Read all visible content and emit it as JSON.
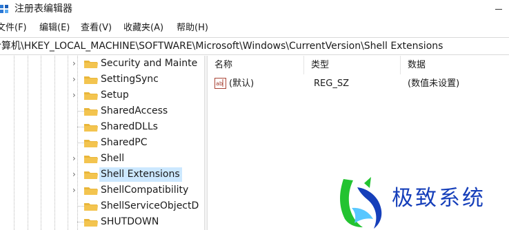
{
  "titlebar": {
    "title": "注册表编辑器",
    "icon": "registry-editor-icon"
  },
  "menubar": {
    "file": "文件(F)",
    "edit": "编辑(E)",
    "view": "查看(V)",
    "favorites": "收藏夹(A)",
    "help": "帮助(H)"
  },
  "addressbar": {
    "path": "计算机\\HKEY_LOCAL_MACHINE\\SOFTWARE\\Microsoft\\Windows\\CurrentVersion\\Shell Extensions"
  },
  "tree": {
    "items": [
      {
        "label": "Security and Mainte",
        "expandable": true,
        "selected": false
      },
      {
        "label": "SettingSync",
        "expandable": true,
        "selected": false
      },
      {
        "label": "Setup",
        "expandable": true,
        "selected": false
      },
      {
        "label": "SharedAccess",
        "expandable": false,
        "selected": false
      },
      {
        "label": "SharedDLLs",
        "expandable": false,
        "selected": false
      },
      {
        "label": "SharedPC",
        "expandable": false,
        "selected": false
      },
      {
        "label": "Shell",
        "expandable": true,
        "selected": false
      },
      {
        "label": "Shell Extensions",
        "expandable": true,
        "selected": true
      },
      {
        "label": "ShellCompatibility",
        "expandable": true,
        "selected": false
      },
      {
        "label": "ShellServiceObjectD",
        "expandable": false,
        "selected": false
      },
      {
        "label": "SHUTDOWN",
        "expandable": false,
        "selected": false
      }
    ]
  },
  "values_pane": {
    "columns": {
      "name": "名称",
      "type": "类型",
      "data": "数据"
    },
    "rows": [
      {
        "name": "(默认)",
        "type": "REG_SZ",
        "data": "(数值未设置)",
        "icon": "string-value-icon"
      }
    ]
  },
  "watermark": {
    "text": "极致系统"
  },
  "colors": {
    "selection": "#cce8ff",
    "folder": "#f3c44f",
    "watermark_blue": "#163fba",
    "watermark_green": "#23c331"
  }
}
